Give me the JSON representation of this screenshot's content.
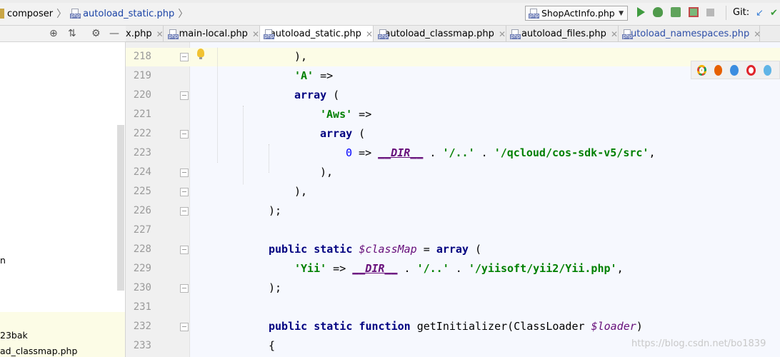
{
  "breadcrumb": {
    "items": [
      "composer",
      "autoload_static.php"
    ]
  },
  "toolbar": {
    "run_config": "ShopActInfo.php",
    "git_label": "Git:"
  },
  "project_panel": {
    "visible_items": [
      "n",
      "23bak",
      "ad_classmap.php"
    ]
  },
  "tabs": [
    {
      "label": "x.php",
      "active": false
    },
    {
      "label": "main-local.php",
      "active": false
    },
    {
      "label": "autoload_static.php",
      "active": true
    },
    {
      "label": "autoload_classmap.php",
      "active": false
    },
    {
      "label": "autoload_files.php",
      "active": false
    },
    {
      "label": "autoload_namespaces.php",
      "active": false
    }
  ],
  "editor": {
    "current_line": 218,
    "lines": [
      {
        "n": "218",
        "indent": 4,
        "tokens": [
          [
            "p",
            "),"
          ]
        ]
      },
      {
        "n": "219",
        "indent": 4,
        "tokens": [
          [
            "s",
            "'A'"
          ],
          [
            "p",
            " =>"
          ]
        ]
      },
      {
        "n": "220",
        "indent": 4,
        "tokens": [
          [
            "k",
            "array"
          ],
          [
            "p",
            " ("
          ]
        ]
      },
      {
        "n": "221",
        "indent": 5,
        "tokens": [
          [
            "s",
            "'Aws'"
          ],
          [
            "p",
            " =>"
          ]
        ]
      },
      {
        "n": "222",
        "indent": 5,
        "tokens": [
          [
            "k",
            "array"
          ],
          [
            "p",
            " ("
          ]
        ]
      },
      {
        "n": "223",
        "indent": 6,
        "tokens": [
          [
            "n",
            "0"
          ],
          [
            "p",
            " => "
          ],
          [
            "c",
            "__DIR__"
          ],
          [
            "p",
            " . "
          ],
          [
            "s",
            "'/..'"
          ],
          [
            "p",
            " . "
          ],
          [
            "s",
            "'/qcloud/cos-sdk-v5/src'"
          ],
          [
            "p",
            ","
          ]
        ]
      },
      {
        "n": "224",
        "indent": 5,
        "tokens": [
          [
            "p",
            "),"
          ]
        ]
      },
      {
        "n": "225",
        "indent": 4,
        "tokens": [
          [
            "p",
            "),"
          ]
        ]
      },
      {
        "n": "226",
        "indent": 3,
        "tokens": [
          [
            "p",
            ");"
          ]
        ]
      },
      {
        "n": "227",
        "indent": 0,
        "tokens": []
      },
      {
        "n": "228",
        "indent": 3,
        "tokens": [
          [
            "k",
            "public"
          ],
          [
            "p",
            " "
          ],
          [
            "k",
            "static"
          ],
          [
            "p",
            " "
          ],
          [
            "v",
            "$classMap"
          ],
          [
            "p",
            " = "
          ],
          [
            "k",
            "array"
          ],
          [
            "p",
            " ("
          ]
        ]
      },
      {
        "n": "229",
        "indent": 4,
        "tokens": [
          [
            "s",
            "'Yii'"
          ],
          [
            "p",
            " => "
          ],
          [
            "c",
            "__DIR__"
          ],
          [
            "p",
            " . "
          ],
          [
            "s",
            "'/..'"
          ],
          [
            "p",
            " . "
          ],
          [
            "s",
            "'/yiisoft/yii2/Yii.php'"
          ],
          [
            "p",
            ","
          ]
        ]
      },
      {
        "n": "230",
        "indent": 3,
        "tokens": [
          [
            "p",
            ");"
          ]
        ]
      },
      {
        "n": "231",
        "indent": 0,
        "tokens": []
      },
      {
        "n": "232",
        "indent": 3,
        "tokens": [
          [
            "k",
            "public"
          ],
          [
            "p",
            " "
          ],
          [
            "k",
            "static"
          ],
          [
            "p",
            " "
          ],
          [
            "k",
            "function"
          ],
          [
            "p",
            " getInitializer(ClassLoader "
          ],
          [
            "v",
            "$loader"
          ],
          [
            "p",
            ")"
          ]
        ]
      },
      {
        "n": "233",
        "indent": 3,
        "tokens": [
          [
            "p",
            "{"
          ]
        ]
      }
    ]
  },
  "browsers": [
    "chrome-icon",
    "firefox-icon",
    "safari-icon",
    "opera-icon",
    "ie-icon"
  ],
  "watermark": "https://blog.csdn.net/bo1839"
}
